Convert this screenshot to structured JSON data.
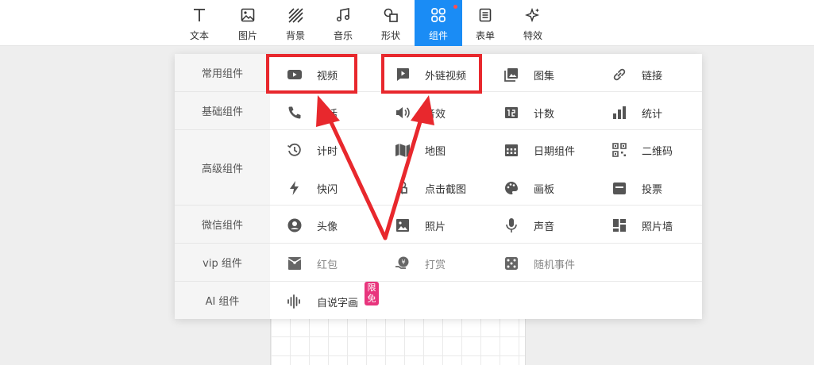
{
  "toolbar": {
    "items": [
      {
        "label": "文本",
        "icon": "text-icon"
      },
      {
        "label": "图片",
        "icon": "image-icon"
      },
      {
        "label": "背景",
        "icon": "background-icon"
      },
      {
        "label": "音乐",
        "icon": "music-icon"
      },
      {
        "label": "形状",
        "icon": "shape-icon"
      },
      {
        "label": "组件",
        "icon": "component-icon",
        "active": true
      },
      {
        "label": "表单",
        "icon": "form-icon"
      },
      {
        "label": "特效",
        "icon": "effect-icon"
      }
    ],
    "active_color": "#1a8cf5"
  },
  "panel": {
    "categories": [
      {
        "label": "常用组件"
      },
      {
        "label": "基础组件"
      },
      {
        "label": "高级组件"
      },
      {
        "label": "微信组件"
      },
      {
        "label": "vip 组件"
      },
      {
        "label": "AI 组件"
      }
    ],
    "items": [
      {
        "label": "视频",
        "icon": "video-icon"
      },
      {
        "label": "外链视频",
        "icon": "external-video-icon"
      },
      {
        "label": "图集",
        "icon": "gallery-icon"
      },
      {
        "label": "链接",
        "icon": "link-icon"
      },
      {
        "label": "电话",
        "icon": "phone-icon"
      },
      {
        "label": "音效",
        "icon": "sound-effect-icon"
      },
      {
        "label": "计数",
        "icon": "counter-icon"
      },
      {
        "label": "统计",
        "icon": "statistics-icon"
      },
      {
        "label": "计时",
        "icon": "timer-icon"
      },
      {
        "label": "地图",
        "icon": "map-icon"
      },
      {
        "label": "日期组件",
        "icon": "calendar-icon"
      },
      {
        "label": "二维码",
        "icon": "qrcode-icon"
      },
      {
        "label": "快闪",
        "icon": "flash-icon"
      },
      {
        "label": "点击截图",
        "icon": "click-screenshot-icon"
      },
      {
        "label": "画板",
        "icon": "palette-icon"
      },
      {
        "label": "投票",
        "icon": "vote-icon"
      },
      {
        "label": "头像",
        "icon": "avatar-icon"
      },
      {
        "label": "照片",
        "icon": "photo-icon"
      },
      {
        "label": "声音",
        "icon": "microphone-icon"
      },
      {
        "label": "照片墙",
        "icon": "photo-wall-icon"
      },
      {
        "label": "红包",
        "icon": "red-packet-icon"
      },
      {
        "label": "打赏",
        "icon": "reward-icon"
      },
      {
        "label": "随机事件",
        "icon": "dice-icon"
      },
      {
        "label": "自说字画",
        "icon": "voice-wave-icon"
      }
    ],
    "badge": "限免"
  },
  "annotation_color": "#e8282d"
}
